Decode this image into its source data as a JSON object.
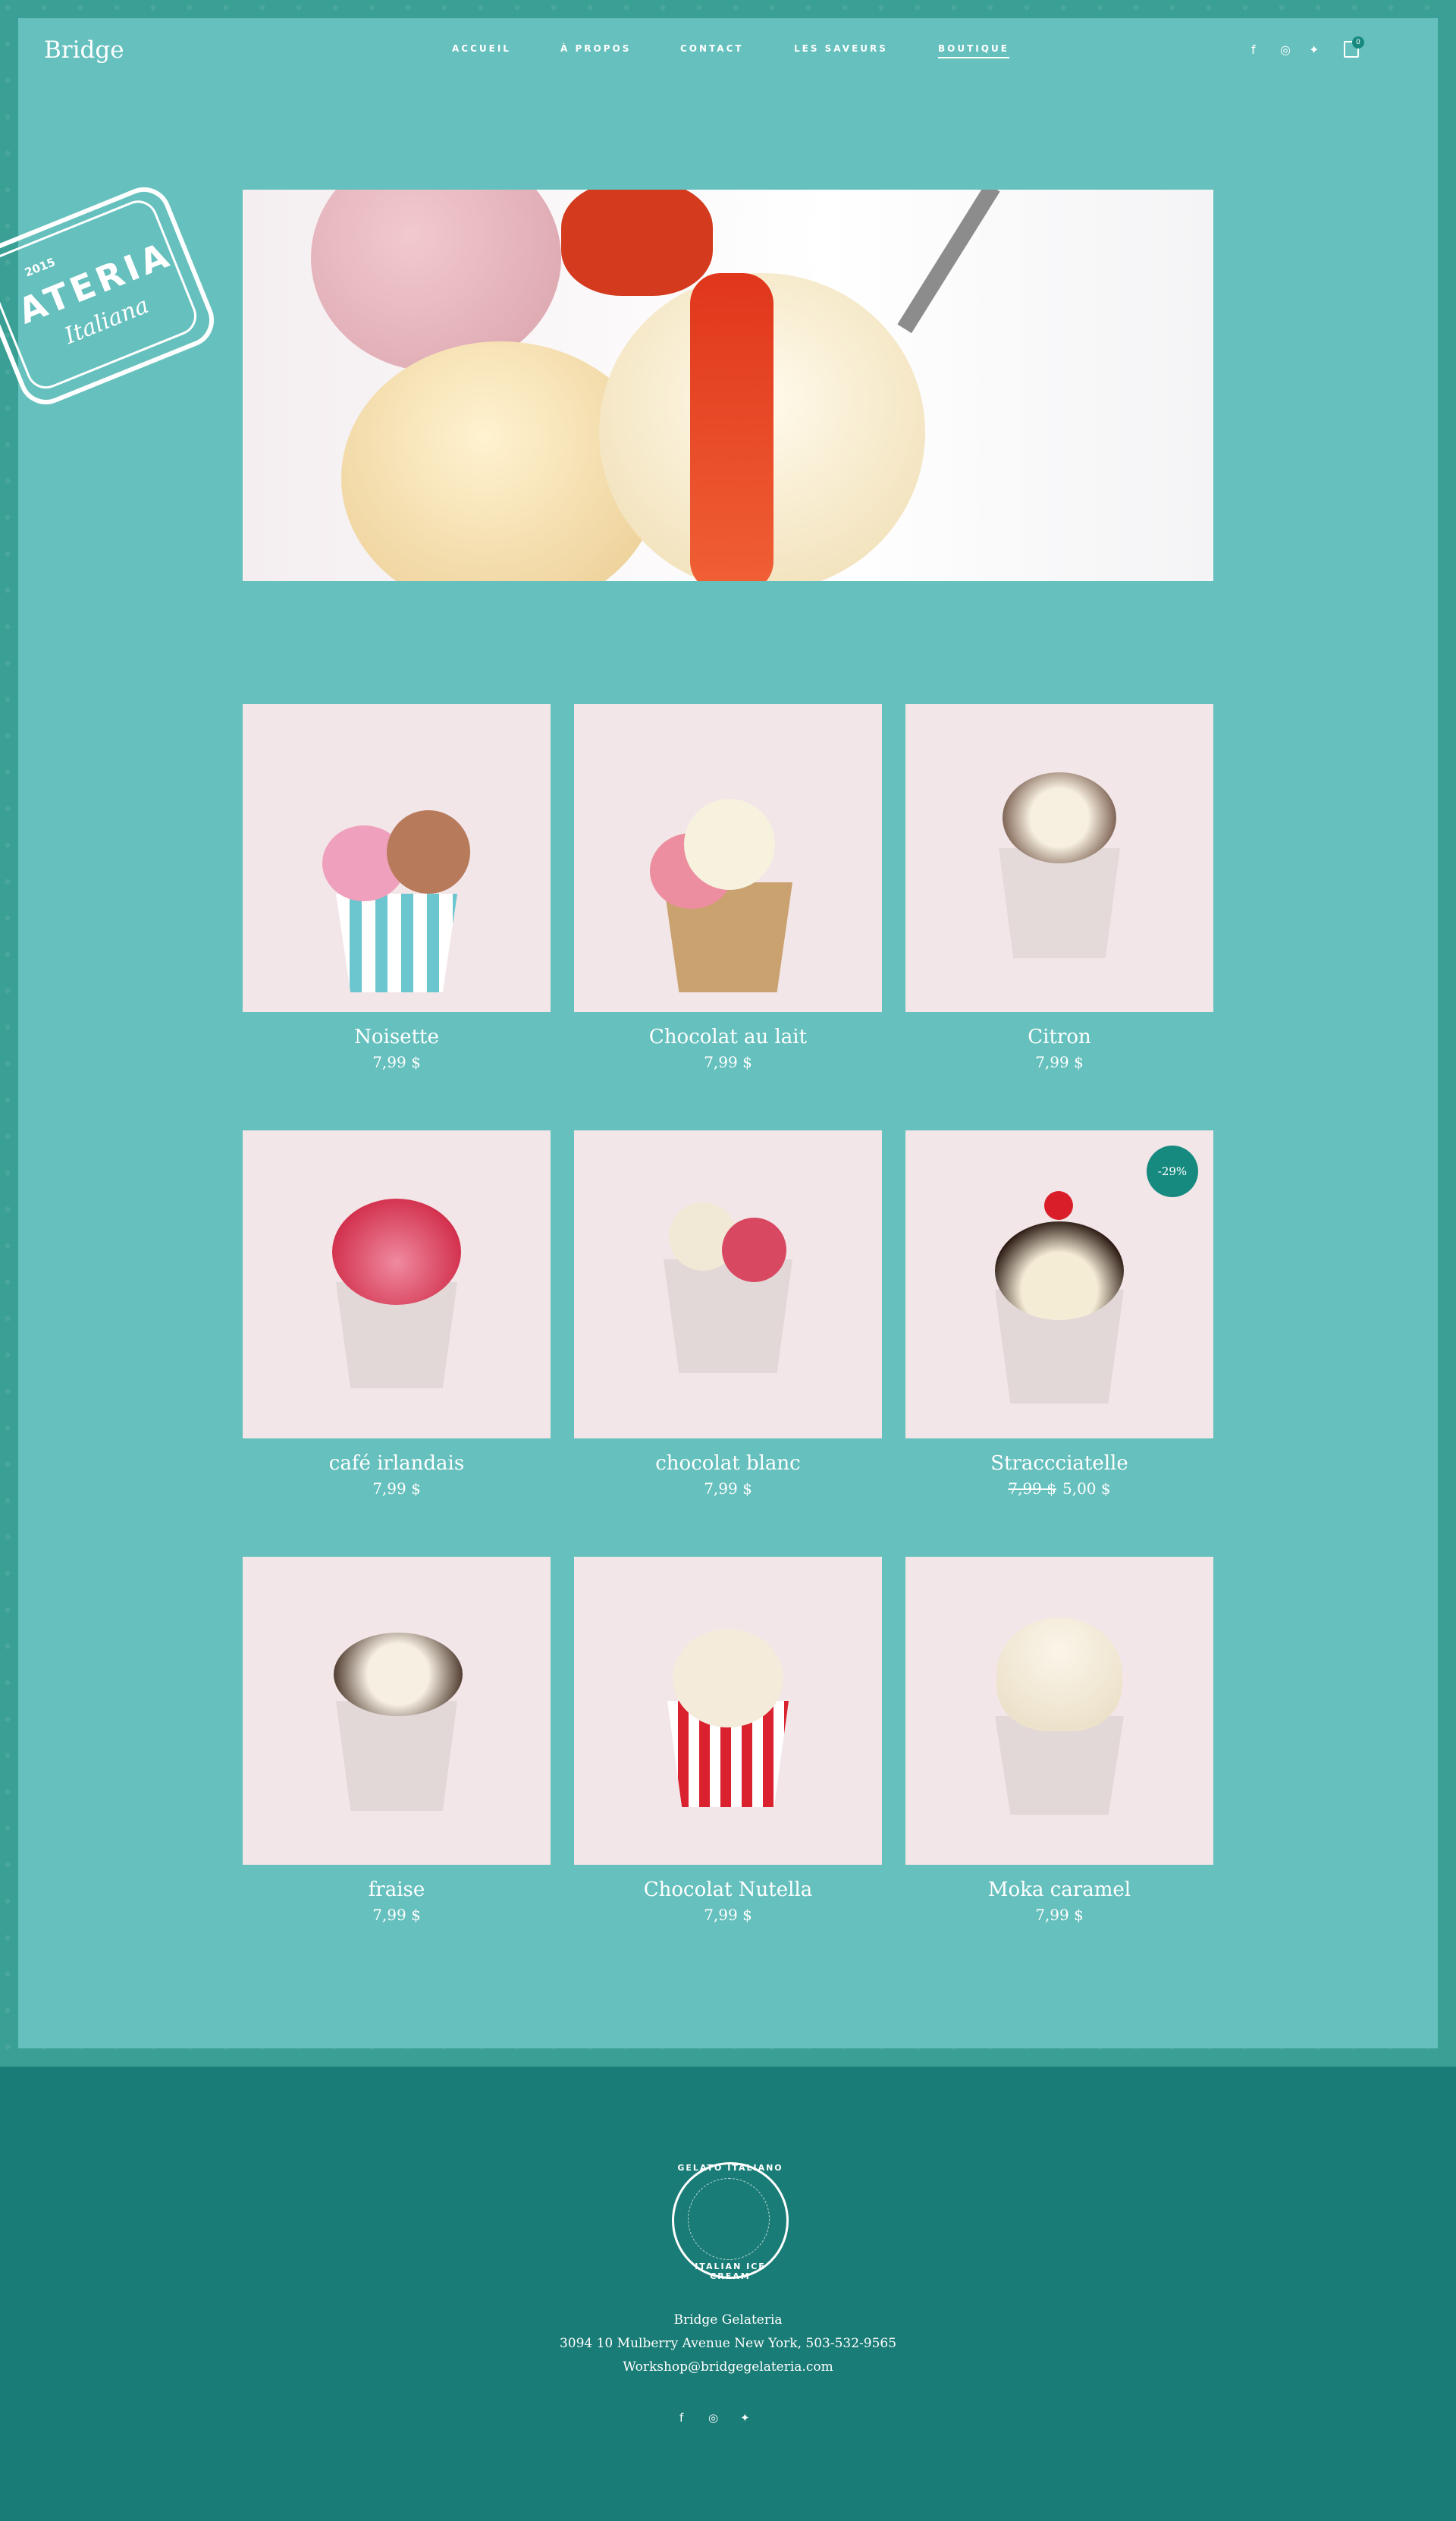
{
  "brand": {
    "name": "Bridge"
  },
  "nav": {
    "items": [
      {
        "label": "ACCUEIL"
      },
      {
        "label": "À PROPOS"
      },
      {
        "label": "CONTACT"
      },
      {
        "label": "LES SAVEURS"
      },
      {
        "label": "BOUTIQUE"
      }
    ],
    "active": "BOUTIQUE"
  },
  "header_icons": {
    "social": [
      "facebook-icon",
      "instagram-icon",
      "twitter-icon"
    ],
    "cart_count": "0"
  },
  "stamp": {
    "year": "2015",
    "name": "ATERIA",
    "sub": "Italiana"
  },
  "products": [
    {
      "name": "Noisette",
      "price": "7,99 $"
    },
    {
      "name": "Chocolat au lait",
      "price": "7,99 $"
    },
    {
      "name": "Citron",
      "price": "7,99 $"
    },
    {
      "name": "café irlandais",
      "price": "7,99 $"
    },
    {
      "name": "chocolat blanc",
      "price": "7,99 $"
    },
    {
      "name": "Straccciatelle",
      "old_price": "7,99 $",
      "price": "5,00 $",
      "badge": "-29%"
    },
    {
      "name": "fraise",
      "price": "7,99 $"
    },
    {
      "name": "Chocolat Nutella",
      "price": "7,99 $"
    },
    {
      "name": "Moka caramel",
      "price": "7,99 $"
    }
  ],
  "footer": {
    "emblem_top": "GELATO ITALIANO",
    "emblem_bottom": "ITALIAN ICE CREAM",
    "company": "Bridge Gelateria",
    "address": "3094 10 Mulberry Avenue New York, 503-532-9565",
    "email": "Workshop@bridgegelateria.com",
    "social": [
      "facebook-icon",
      "instagram-icon",
      "twitter-icon"
    ]
  },
  "colors": {
    "frame": "#66c0bd",
    "border": "#3a9f95",
    "footer": "#1a7c76",
    "accent": "#178a80",
    "card_bg": "#f3e6e8"
  }
}
